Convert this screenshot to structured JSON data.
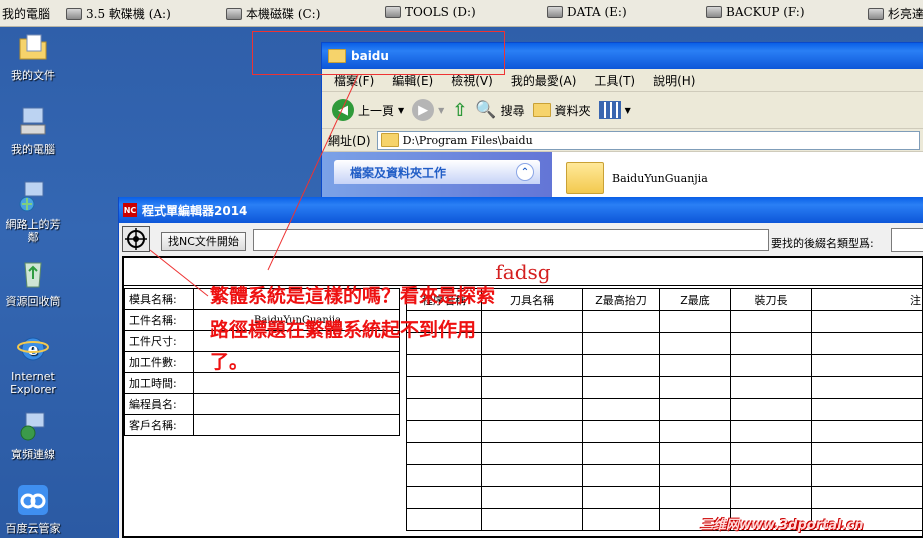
{
  "drivebar": {
    "drives": [
      {
        "label": "我的電腦"
      },
      {
        "label": "3.5 軟碟機 (A:)"
      },
      {
        "label": "本機磁碟 (C:)"
      },
      {
        "label": "TOOLS (D:)"
      },
      {
        "label": "DATA (E:)"
      },
      {
        "label": "BACKUP (F:)"
      },
      {
        "label": "杉亮達"
      }
    ]
  },
  "desktop": {
    "icons": [
      {
        "label": "我的文件",
        "icon": "my-documents-icon"
      },
      {
        "label": "我的電腦",
        "icon": "my-computer-icon"
      },
      {
        "label": "網路上的芳鄰",
        "icon": "network-places-icon"
      },
      {
        "label": "資源回收筒",
        "icon": "recycle-bin-icon"
      },
      {
        "label": "Internet Explorer",
        "icon": "internet-explorer-icon"
      },
      {
        "label": "寬頻連線",
        "icon": "broadband-icon"
      },
      {
        "label": "百度云管家",
        "icon": "baidu-cloud-icon"
      }
    ]
  },
  "explorer": {
    "title": "baidu",
    "menu": [
      "檔案(F)",
      "編輯(E)",
      "檢視(V)",
      "我的最愛(A)",
      "工具(T)",
      "說明(H)"
    ],
    "toolbar": {
      "back": "上一頁",
      "search": "搜尋",
      "folders": "資料夾"
    },
    "address_label": "網址(D)",
    "address_value": "D:\\Program Files\\baidu",
    "task_pane_title": "檔案及資料夾工作",
    "file_item": "BaiduYunGuanjia"
  },
  "ncapp": {
    "title": "程式單編輯器2014",
    "find_button": "找NC文件開始",
    "path_value": "",
    "ext_label": "要找的後綴名類型爲:",
    "ext_value": "",
    "form_title": "fadsg",
    "info_rows": [
      {
        "label": "模具名稱:",
        "value": ""
      },
      {
        "label": "工件名稱:",
        "value": "BaiduYunGuanjia"
      },
      {
        "label": "工件尺寸:",
        "value": ""
      },
      {
        "label": "加工件數:",
        "value": ""
      },
      {
        "label": "加工時間:",
        "value": ""
      },
      {
        "label": "編程員名:",
        "value": ""
      },
      {
        "label": "客戶名稱:",
        "value": ""
      }
    ],
    "tool_headers": [
      "程序名稱",
      "刀具名稱",
      "Z最高抬刀",
      "Z最底",
      "裝刀長",
      "注"
    ]
  },
  "annotation": {
    "lines": [
      "繁體系統是這樣的嗎？看來是探索",
      "路徑標題在繁體系統起不到作用",
      "了。"
    ]
  },
  "watermark": "三维网www.3dportal.cn",
  "colors": {
    "annotation": "#e11111",
    "title_bar": "#0a5fe6",
    "form_title": "#d42020"
  }
}
